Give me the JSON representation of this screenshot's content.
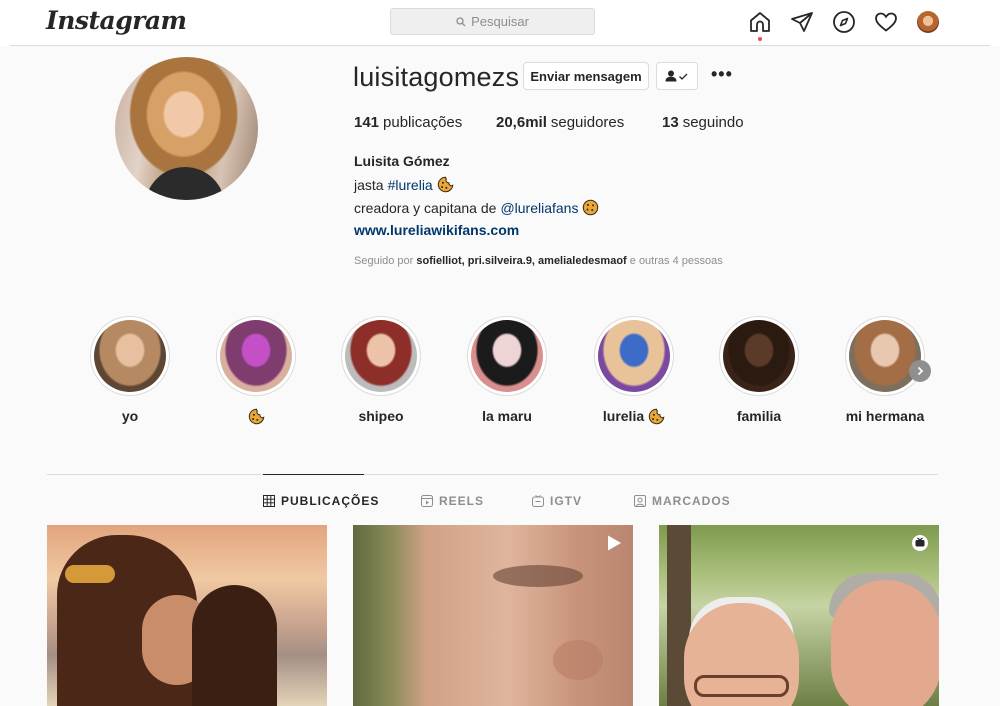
{
  "header": {
    "logo": "Instagram",
    "search_placeholder": "Pesquisar"
  },
  "profile": {
    "username": "luisitagomezs",
    "message_button": "Enviar mensagem",
    "stats": {
      "posts_count": "141",
      "posts_label": "publicações",
      "followers_count": "20,6mil",
      "followers_label": "seguidores",
      "following_count": "13",
      "following_label": "seguindo"
    },
    "bio": {
      "name": "Luisita Gómez",
      "line1_prefix": "jasta",
      "line1_tag": "#lurelia",
      "line2_prefix": "creadora y capitana de",
      "line2_mention": "@lureliafans",
      "website": "www.lureliawikifans.com"
    },
    "followed_by": {
      "prefix": "Seguido por",
      "users": "sofielliot, pri.silveira.9, amelialedesmaof",
      "suffix": "e outras 4 pessoas"
    }
  },
  "stories": [
    {
      "label": "yo",
      "emoji_after": false,
      "colors": [
        "#e8c0a0",
        "#b58a62",
        "#5e4634"
      ]
    },
    {
      "label": "",
      "emoji_after": true,
      "colors": [
        "#c54fc7",
        "#7e3d6e",
        "#d9b0a0"
      ]
    },
    {
      "label": "shipeo",
      "emoji_after": false,
      "colors": [
        "#ecc2a8",
        "#8e2e28",
        "#bcbcbc"
      ]
    },
    {
      "label": "la maru",
      "emoji_after": false,
      "colors": [
        "#eed4d4",
        "#1b1b1b",
        "#d98f8f"
      ]
    },
    {
      "label": "lurelia",
      "emoji_after": true,
      "colors": [
        "#3c6bc8",
        "#e8c39a",
        "#7b4aa0"
      ]
    },
    {
      "label": "familia",
      "emoji_after": false,
      "colors": [
        "#5a3a28",
        "#2a1a10",
        "#3a2418"
      ]
    },
    {
      "label": "mi hermana",
      "emoji_after": false,
      "colors": [
        "#e9c8b0",
        "#a36d45",
        "#7c6f5e"
      ]
    }
  ],
  "tabs": [
    {
      "label": "PUBLICAÇÕES",
      "icon": "grid-icon",
      "active": true
    },
    {
      "label": "REELS",
      "icon": "reels-icon",
      "active": false
    },
    {
      "label": "IGTV",
      "icon": "igtv-icon",
      "active": false
    },
    {
      "label": "MARCADOS",
      "icon": "tagged-icon",
      "active": false
    }
  ],
  "posts": [
    {
      "type": "photo"
    },
    {
      "type": "video",
      "badge": "play-icon"
    },
    {
      "type": "igtv",
      "badge": "igtv-icon"
    }
  ]
}
